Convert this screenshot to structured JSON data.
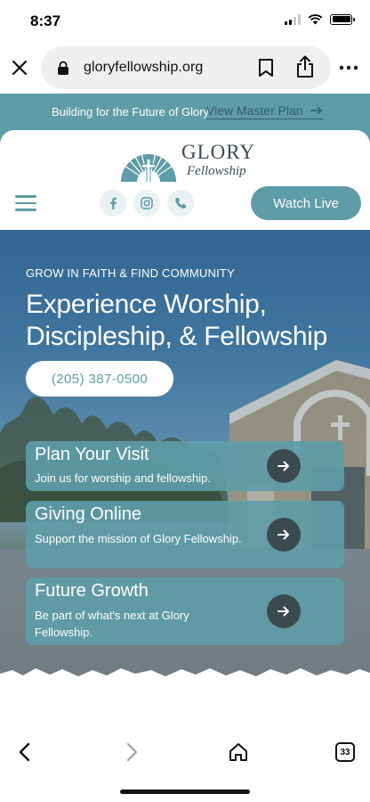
{
  "status_bar": {
    "time": "8:37"
  },
  "browser": {
    "url": "gloryfellowship.org",
    "tab_count": "33"
  },
  "banner": {
    "text": "Building for the Future of Glory",
    "link_label": "View Master Plan"
  },
  "header": {
    "logo_word": "GLORY",
    "logo_script": "Fellowship",
    "watch_live_label": "Watch Live",
    "social_icons": [
      "facebook-icon",
      "instagram-icon",
      "phone-icon"
    ]
  },
  "hero": {
    "eyebrow": "GROW IN FAITH & FIND COMMUNITY",
    "title": "Experience Worship, Discipleship, & Fellowship",
    "phone": "(205) 387-0500"
  },
  "cards": [
    {
      "title": "Plan Your Visit",
      "desc": "Join us for worship and fellowship."
    },
    {
      "title": "Giving Online",
      "desc": "Support the mission of Glory Fellowship."
    },
    {
      "title": "Future Growth",
      "desc": "Be part of what's next at Glory Fellowship."
    }
  ],
  "colors": {
    "accent": "#5e9ca7",
    "accent_dark": "#2f5f6a",
    "arrow_bg": "#3a4a4f"
  }
}
